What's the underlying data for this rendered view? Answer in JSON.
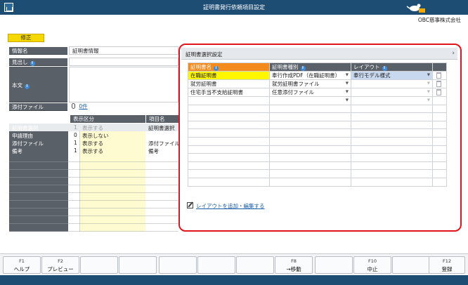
{
  "window": {
    "title": "証明書発行依頼項目設定",
    "company": "OBC慈事株式会社"
  },
  "tag": "修正",
  "form": {
    "info_name_label": "情報名",
    "info_name_value": "証明書情報",
    "heading_label": "見出し",
    "body_label": "本文",
    "attachment_label": "添付ファイル",
    "attachment_value": "0件"
  },
  "left_grid": {
    "col_display": "表示区分",
    "col_item": "項目名",
    "rows": [
      {
        "name": "証明書選択",
        "num": "1",
        "display": "表示する",
        "item": "証明書選択"
      },
      {
        "name": "申請理由",
        "num": "0",
        "display": "表示しない",
        "item": ""
      },
      {
        "name": "添付ファイル",
        "num": "1",
        "display": "表示する",
        "item": "添付ファイル"
      },
      {
        "name": "備考",
        "num": "1",
        "display": "表示する",
        "item": "備考"
      }
    ]
  },
  "panel": {
    "title": "証明書選択設定",
    "headers": [
      "証明書名",
      "証明書種別",
      "レイアウト"
    ],
    "rows": [
      {
        "name": "在職証明書",
        "type": "奉行作成PDF（在職証明書）",
        "layout": "奉行モデル様式"
      },
      {
        "name": "就労証明書",
        "type": "就労証明書ファイル",
        "layout": ""
      },
      {
        "name": "住宅手当不支給証明書",
        "type": "任意添付ファイル",
        "layout": ""
      }
    ],
    "add_link": "レイアウトを追加・編集する"
  },
  "fkeys": [
    {
      "key": "F1",
      "label": "ヘルプ"
    },
    {
      "key": "F2",
      "label": "プレビュー"
    },
    {
      "key": "",
      "label": ""
    },
    {
      "key": "",
      "label": ""
    },
    {
      "key": "",
      "label": ""
    },
    {
      "key": "",
      "label": ""
    },
    {
      "key": "",
      "label": ""
    },
    {
      "key": "F8",
      "label": "→移動"
    },
    {
      "key": "",
      "label": ""
    },
    {
      "key": "F10",
      "label": "中止"
    },
    {
      "key": "",
      "label": ""
    },
    {
      "key": "F12",
      "label": "登録"
    }
  ],
  "colors": {
    "titlebar": "#1e4d74",
    "highlight_border": "#e1141c",
    "tag": "#f5d800",
    "orange_header": "#f28a1e"
  },
  "icons": {
    "home": "home-icon",
    "logo": "obc-logo-icon",
    "info": "info-icon",
    "clip": "paperclip-icon",
    "trash": "trash-icon",
    "edit": "edit-icon",
    "dropdown": "chevron-down-icon"
  }
}
